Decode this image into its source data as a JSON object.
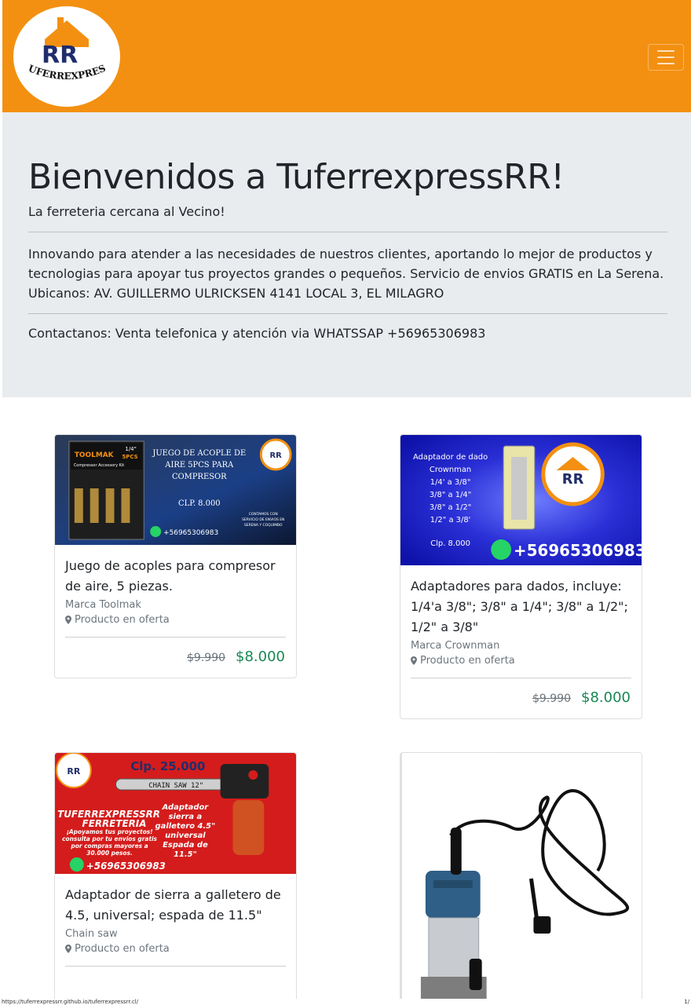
{
  "brand": {
    "logo_text": "TUFERREXPRESS",
    "logo_initials": "RR",
    "menu_icon": "hamburger-icon"
  },
  "hero": {
    "title": "Bienvenidos a TuferrexpressRR!",
    "lead": "La ferreteria cercana al Vecino!",
    "description_lines": [
      "Innovando para atender a las necesidades de nuestros clientes, aportando lo mejor de productos y",
      "tecnologias para apoyar tus proyectos grandes o pequeños. Servicio de envios GRATIS en La Serena.",
      "Ubicanos: AV. GUILLERMO ULRICKSEN 4141 LOCAL 3, EL MILAGRO"
    ],
    "contact": "Contactanos: Venta telefonica y atención via WHATSSAP +56965306983"
  },
  "products": [
    {
      "title": "Juego de acoples para compresor de aire, 5 piezas.",
      "brand": "Marca Toolmak",
      "offer": "Producto en oferta",
      "old_price": "$9.990",
      "new_price": "$8.000",
      "image": {
        "lines": [
          "JUEGO DE ACOPLE DE",
          "AIRE 5PCS PARA",
          "COMPRESOR"
        ],
        "price": "CLP. 8.000",
        "phone": "+56965306983",
        "box_brand": "TOOLMAK",
        "box_size": "1/4\"",
        "box_pcs": "5PCS",
        "box_caption": "Compressor Accessory Kit",
        "note_lines": [
          "CONTAMOS CON",
          "SERVICIO DE ENVIOS EN",
          "SERENA Y COQUIMBO"
        ]
      }
    },
    {
      "title": "Adaptadores para dados, incluye: 1/4'a 3/8\"; 3/8\" a 1/4\"; 3/8\" a 1/2\"; 1/2\" a 3/8\"",
      "brand": "Marca Crownman",
      "offer": "Producto en oferta",
      "old_price": "$9.990",
      "new_price": "$8.000",
      "image": {
        "lines": [
          "Adaptador de dado",
          "Crownman",
          "1/4' a 3/8\"",
          "3/8\" a 1/4\"",
          "3/8\" a 1/2\"",
          "1/2\" a 3/8'"
        ],
        "price": "Clp. 8.000",
        "phone": "+56965306983"
      }
    },
    {
      "title": "Adaptador de sierra a galletero de 4.5, universal; espada de 11.5\"",
      "brand": "Chain saw",
      "offer": "Producto en oferta",
      "image": {
        "price": "Clp. 25.000",
        "chain_label": "CHAIN SAW 12\"",
        "store_lines": [
          "TUFERREXPRESSRR",
          "FERRETERIA"
        ],
        "promo_lines": [
          "¡Apoyamos tus proyectos!",
          "consulta por tu envios gratis",
          "por compras mayores a",
          "30.000 pesos."
        ],
        "desc_lines": [
          "Adaptador",
          "sierra a",
          "galletero 4.5\"",
          "universal",
          "Espada de",
          "11.5\""
        ],
        "phone": "+56965306983"
      }
    },
    {
      "image": {
        "subject": "router"
      }
    }
  ],
  "status_bar": {
    "url": "https://tuferrexpressrr.github.io/tuferrexpressrr.cl/",
    "page": "1/"
  },
  "colors": {
    "navbar": "#f39011",
    "jumbotron": "#e9ecef",
    "price_green": "#198754",
    "muted": "#6c757d"
  }
}
